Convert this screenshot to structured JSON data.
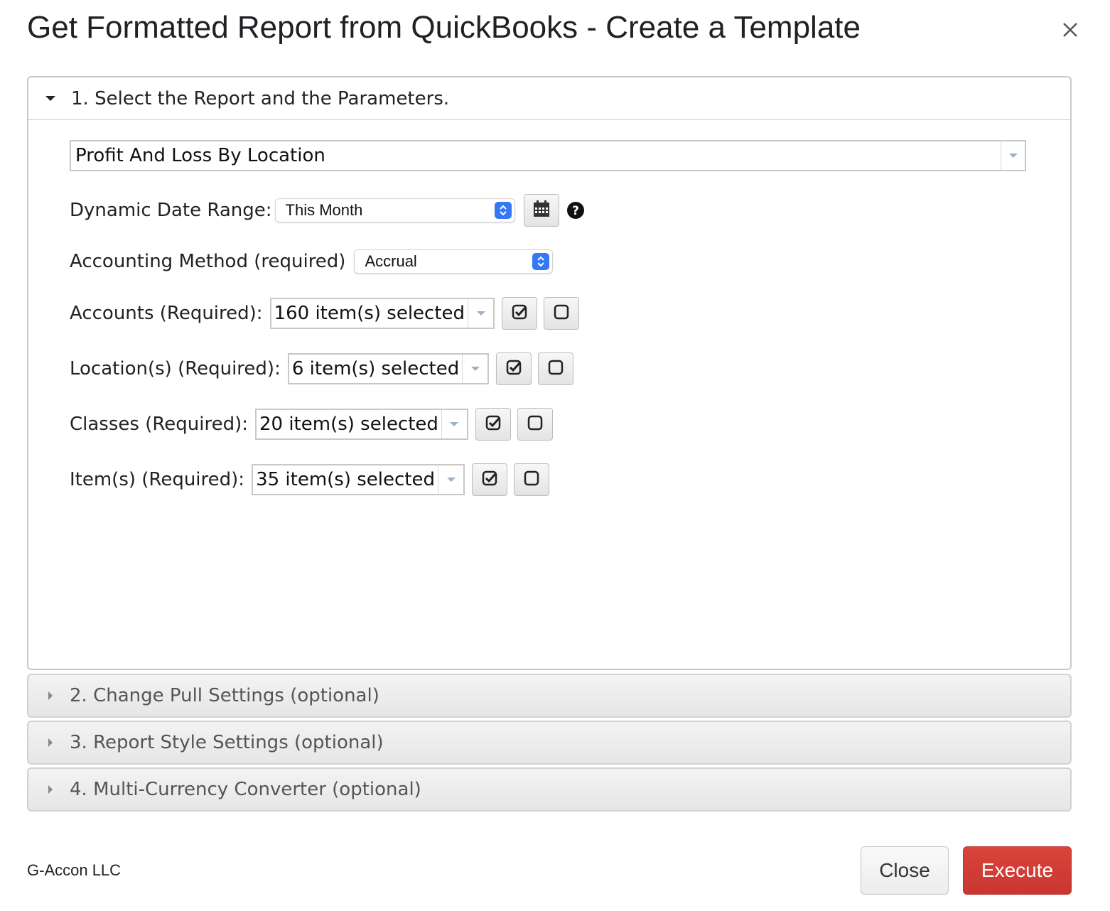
{
  "dialog": {
    "title": "Get Formatted Report from QuickBooks - Create a Template",
    "close_icon": "close-icon"
  },
  "sections": [
    {
      "label": "1. Select the Report and the Parameters.",
      "expanded": true
    },
    {
      "label": "2. Change Pull Settings (optional)",
      "expanded": false
    },
    {
      "label": "3. Report Style Settings (optional)",
      "expanded": false
    },
    {
      "label": "4. Multi-Currency Converter (optional)",
      "expanded": false
    }
  ],
  "report": {
    "selected": "Profit And Loss By Location"
  },
  "date_range": {
    "label": "Dynamic Date Range:",
    "value": "This Month",
    "calendar_icon": "calendar-icon",
    "help_icon": "help-icon"
  },
  "accounting_method": {
    "label": "Accounting Method (required)",
    "value": "Accrual"
  },
  "filters": [
    {
      "label": "Accounts (Required):",
      "value": "160 item(s) selected"
    },
    {
      "label": "Location(s) (Required):",
      "value": "6 item(s) selected"
    },
    {
      "label": "Classes (Required):",
      "value": "20 item(s) selected"
    },
    {
      "label": "Item(s) (Required):",
      "value": "35 item(s) selected"
    }
  ],
  "footer": {
    "company": "G-Accon LLC",
    "close_label": "Close",
    "execute_label": "Execute"
  },
  "colors": {
    "execute": "#d13c35",
    "select_accent": "#3478f6"
  }
}
